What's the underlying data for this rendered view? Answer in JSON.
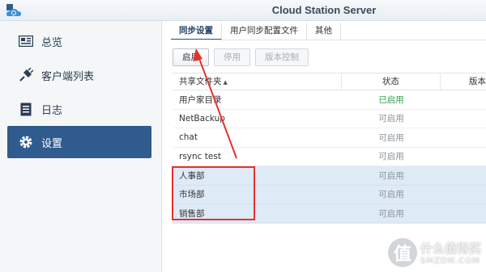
{
  "app": {
    "title": "Cloud Station Server"
  },
  "sidebar": {
    "items": [
      {
        "label": "总览",
        "icon": "overview-card-icon",
        "active": false
      },
      {
        "label": "客户端列表",
        "icon": "plug-icon",
        "active": false
      },
      {
        "label": "日志",
        "icon": "log-list-icon",
        "active": false
      },
      {
        "label": "设置",
        "icon": "gear-icon",
        "active": true
      }
    ]
  },
  "tabs": [
    {
      "label": "同步设置",
      "active": true
    },
    {
      "label": "用户同步配置文件",
      "active": false
    },
    {
      "label": "其他",
      "active": false
    }
  ],
  "toolbar": {
    "enable_label": "启用",
    "disable_label": "停用",
    "version_label": "版本控制"
  },
  "table": {
    "headers": {
      "folder": "共享文件夹",
      "status": "状态",
      "version": "版本"
    },
    "rows": [
      {
        "folder": "用户家目录",
        "status": "已启用"
      },
      {
        "folder": "NetBackup",
        "status": "可启用"
      },
      {
        "folder": "chat",
        "status": "可启用"
      },
      {
        "folder": "rsync test",
        "status": "可启用"
      },
      {
        "folder": "人事部",
        "status": "可启用"
      },
      {
        "folder": "市场部",
        "status": "可启用"
      },
      {
        "folder": "销售部",
        "status": "可启用"
      }
    ]
  },
  "watermark": {
    "cn": "什么值得买",
    "en": "SMZDM.COM"
  },
  "colors": {
    "accent": "#2f5b8f",
    "enabled_green": "#2ea44f",
    "annotation_red": "#e5322d",
    "selected_row": "#dfeaf7"
  }
}
